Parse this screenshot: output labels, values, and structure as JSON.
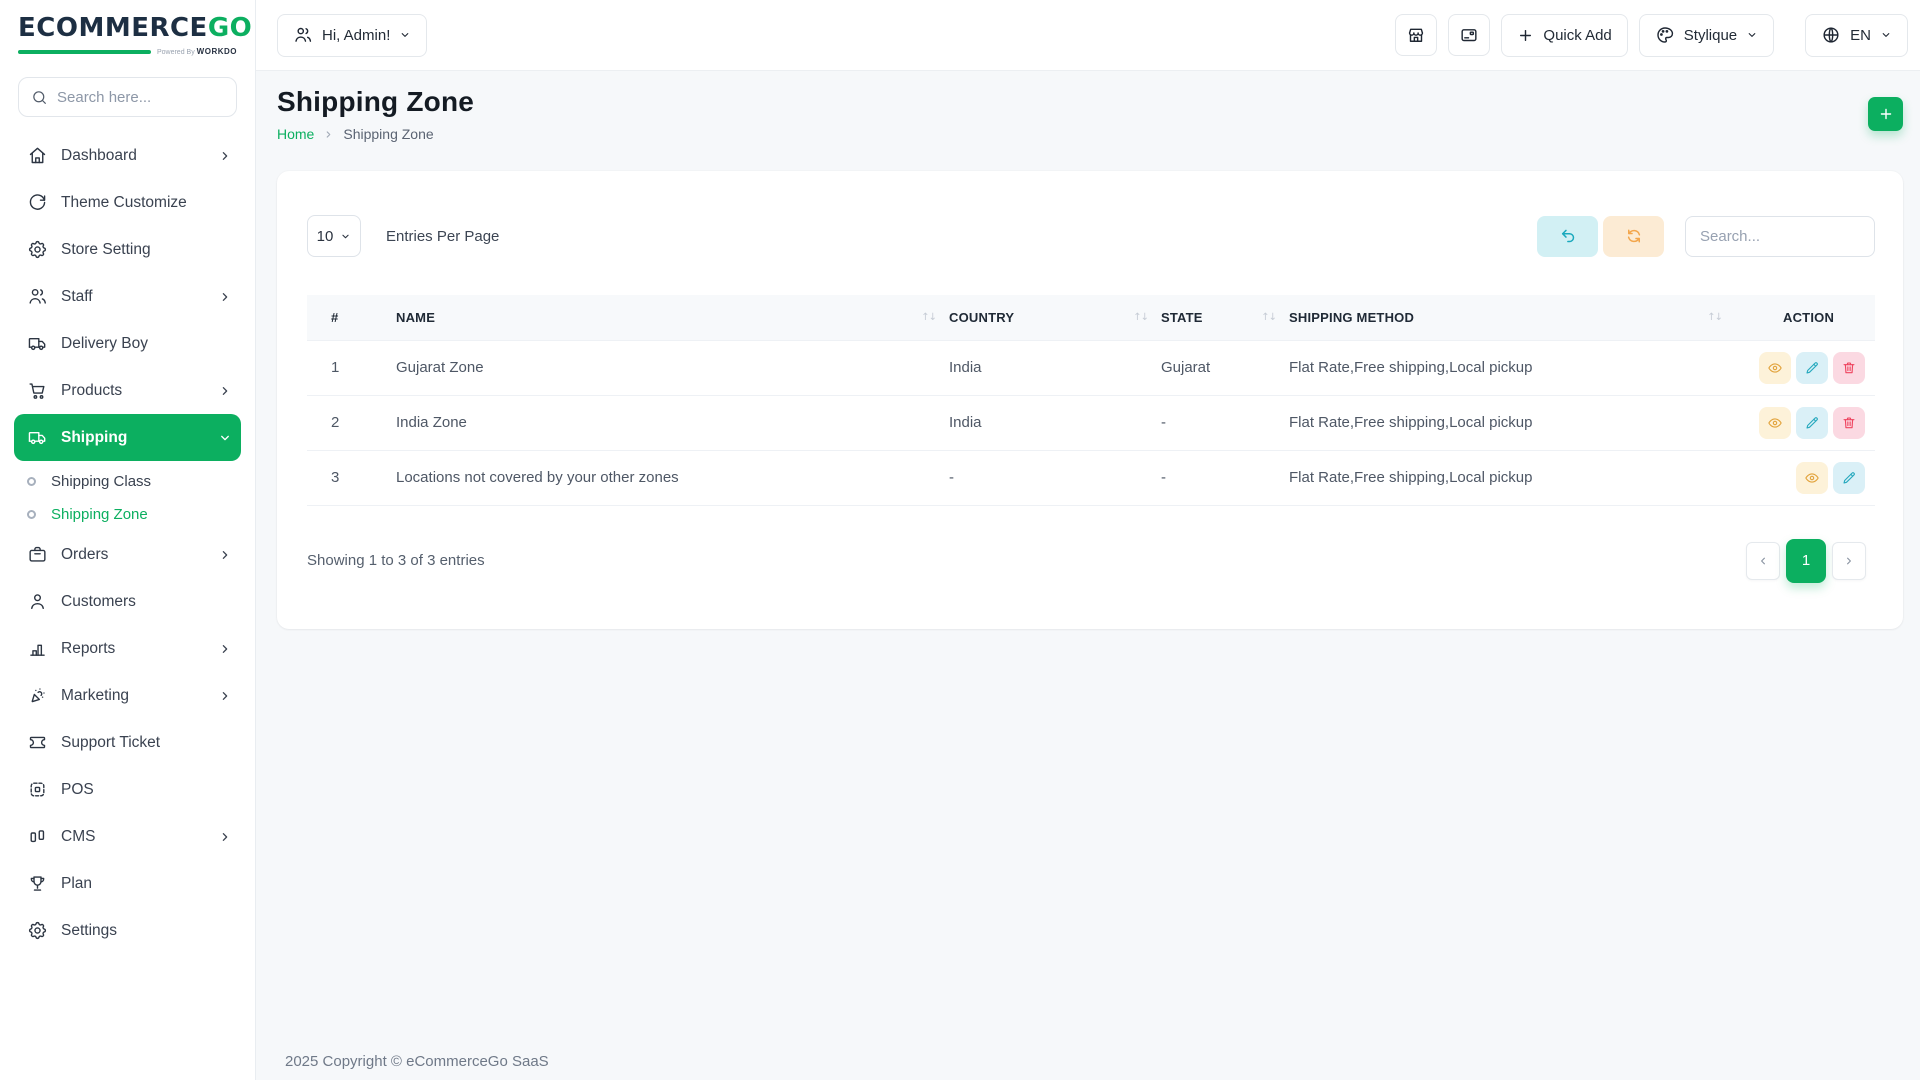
{
  "brand": {
    "name_primary": "ECOMMERCE",
    "name_secondary": "GO",
    "powered_by": "Powered By",
    "powered_brand": "WORKDO"
  },
  "colors": {
    "accent": "#0caf60",
    "logo_navy": "#1d2f43",
    "view_bg": "#fdf2d9",
    "view_icon": "#e2a33c",
    "edit_bg": "#daf0f7",
    "edit_icon": "#27a9be",
    "delete_bg": "#fbd9e2",
    "delete_icon": "#ee4560",
    "undo_bg": "#d2f0f4",
    "undo_icon": "#1ba9bd",
    "refresh_bg": "#fcebd4",
    "refresh_icon": "#f3a64c"
  },
  "sidebar": {
    "search_placeholder": "Search here...",
    "items": [
      {
        "label": "Dashboard",
        "icon": "home-icon",
        "chevron": "right"
      },
      {
        "label": "Theme Customize",
        "icon": "theme-icon"
      },
      {
        "label": "Store Setting",
        "icon": "gear-icon"
      },
      {
        "label": "Staff",
        "icon": "users-icon",
        "chevron": "right"
      },
      {
        "label": "Delivery Boy",
        "icon": "truck-icon"
      },
      {
        "label": "Products",
        "icon": "cart-icon",
        "chevron": "right"
      },
      {
        "label": "Shipping",
        "icon": "truck-icon",
        "chevron": "down",
        "active": true,
        "sub": [
          {
            "label": "Shipping Class",
            "active": false
          },
          {
            "label": "Shipping Zone",
            "active": true
          }
        ]
      },
      {
        "label": "Orders",
        "icon": "briefcase-icon",
        "chevron": "right"
      },
      {
        "label": "Customers",
        "icon": "user-icon"
      },
      {
        "label": "Reports",
        "icon": "chart-icon",
        "chevron": "right"
      },
      {
        "label": "Marketing",
        "icon": "megaphone-icon",
        "chevron": "right"
      },
      {
        "label": "Support Ticket",
        "icon": "ticket-icon"
      },
      {
        "label": "POS",
        "icon": "pos-icon"
      },
      {
        "label": "CMS",
        "icon": "cms-icon",
        "chevron": "right"
      },
      {
        "label": "Plan",
        "icon": "trophy-icon"
      },
      {
        "label": "Settings",
        "icon": "gear-icon"
      }
    ]
  },
  "topbar": {
    "admin_label": "Hi, Admin!",
    "quick_add_label": "Quick Add",
    "theme_label": "Stylique",
    "language_label": "EN"
  },
  "page": {
    "title": "Shipping Zone",
    "breadcrumb": [
      {
        "label": "Home"
      },
      {
        "label": "Shipping Zone"
      }
    ],
    "footer": "2025 Copyright © eCommerceGo SaaS"
  },
  "table_card": {
    "entries_per_page_value": "10",
    "entries_per_page_label": "Entries Per Page",
    "search_placeholder": "Search...",
    "sort_glyph": "↑↓",
    "columns": [
      "#",
      "NAME",
      "COUNTRY",
      "STATE",
      "SHIPPING METHOD",
      "ACTION"
    ],
    "rows": [
      {
        "num": "1",
        "name": "Gujarat Zone",
        "country": "India",
        "state": "Gujarat",
        "shipping_method": "Flat Rate,Free shipping,Local pickup",
        "actions": [
          "view",
          "edit",
          "delete"
        ]
      },
      {
        "num": "2",
        "name": "India Zone",
        "country": "India",
        "state": "-",
        "shipping_method": "Flat Rate,Free shipping,Local pickup",
        "actions": [
          "view",
          "edit",
          "delete"
        ]
      },
      {
        "num": "3",
        "name": "Locations not covered by your other zones",
        "country": "-",
        "state": "-",
        "shipping_method": "Flat Rate,Free shipping,Local pickup",
        "actions": [
          "view",
          "edit"
        ]
      }
    ],
    "showing_text": "Showing 1 to 3 of 3 entries",
    "pagination": {
      "current_page": "1"
    }
  }
}
